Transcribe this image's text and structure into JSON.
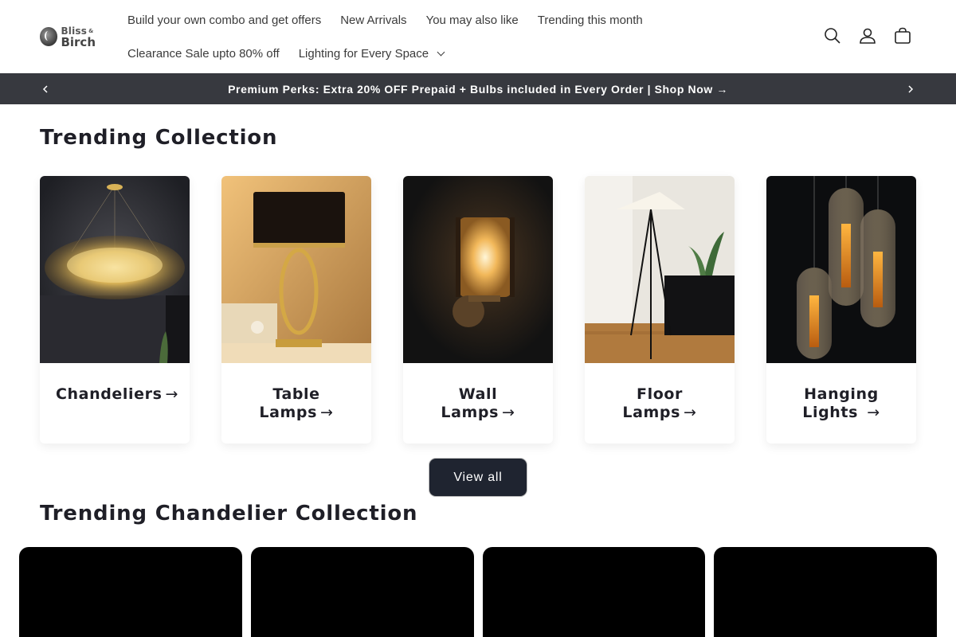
{
  "brand": {
    "logo_line1": "Bliss",
    "logo_amp": "&",
    "logo_line2": "Birch"
  },
  "nav": {
    "row1": [
      "Build your own combo and get offers",
      "New Arrivals",
      "You may also like",
      "Trending this month"
    ],
    "row2": [
      "Clearance Sale upto 80% off",
      "Lighting for Every Space"
    ]
  },
  "header_icons": [
    "search-icon",
    "account-icon",
    "cart-icon"
  ],
  "announcement": {
    "text": "Premium Perks: Extra 20% OFF Prepaid + Bulbs included in Every Order | Shop Now →"
  },
  "trending_collection": {
    "title": "Trending Collection",
    "cards": [
      {
        "label": "Chandeliers"
      },
      {
        "label": "Table Lamps"
      },
      {
        "label": "Wall Lamps"
      },
      {
        "label": "Floor Lamps"
      },
      {
        "label": "Hanging Lights"
      }
    ],
    "view_all": "View all"
  },
  "chandelier_collection": {
    "title": "Trending Chandelier Collection",
    "video_count_visible": 4
  },
  "colors": {
    "announcement_bg": "#37393f",
    "button_bg": "#1f2430",
    "text": "#1f1f27"
  }
}
